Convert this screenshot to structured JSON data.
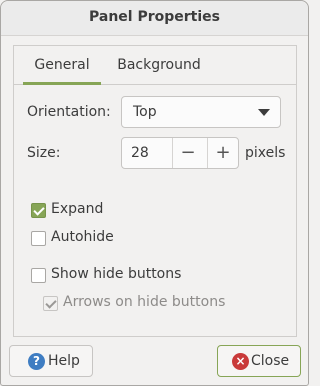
{
  "window": {
    "title": "Panel Properties"
  },
  "tabs": [
    {
      "label": "General",
      "active": true
    },
    {
      "label": "Background",
      "active": false
    }
  ],
  "general": {
    "orientation_label": "Orientation:",
    "orientation_value": "Top",
    "size_label": "Size:",
    "size_value": "28",
    "size_minus": "−",
    "size_plus": "+",
    "size_unit": "pixels",
    "expand_label": "Expand",
    "expand_checked": true,
    "autohide_label": "Autohide",
    "autohide_checked": false,
    "show_hide_buttons_label": "Show hide buttons",
    "show_hide_buttons_checked": false,
    "arrows_label": "Arrows on hide buttons",
    "arrows_checked": true,
    "arrows_enabled": false
  },
  "buttons": {
    "help_label": "Help",
    "close_label": "Close",
    "help_icon": "?",
    "close_icon": "×"
  },
  "colors": {
    "accent": "#87a556",
    "help_icon": "#3f7dc2",
    "close_icon": "#c93a3a"
  }
}
